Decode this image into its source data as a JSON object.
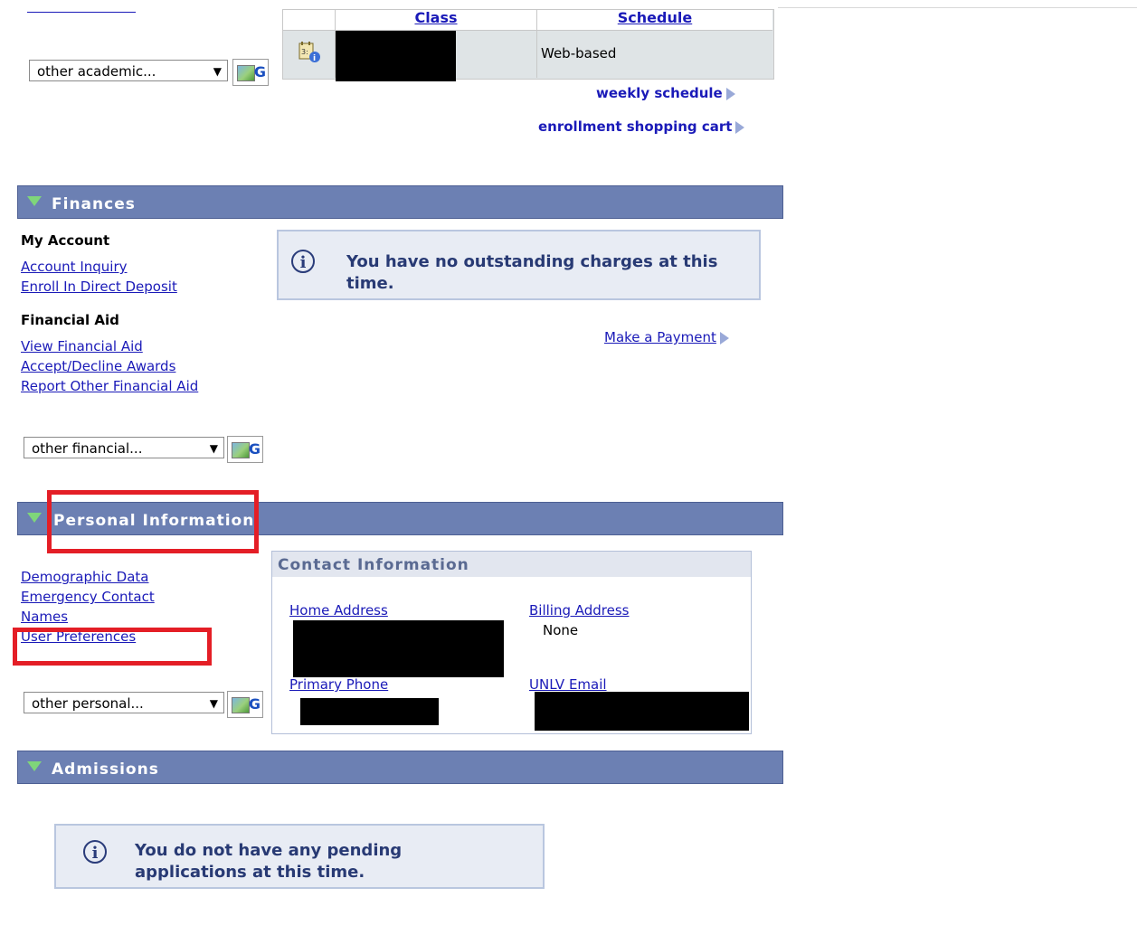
{
  "enrollment": {
    "table": {
      "headers": [
        "",
        "Class",
        "Schedule"
      ],
      "rows": [
        {
          "class": "",
          "schedule": "Web-based"
        }
      ]
    },
    "weekly_schedule_label": "weekly schedule",
    "shopping_cart_label": "enrollment shopping cart",
    "other_select": "other academic..."
  },
  "finances": {
    "title": "Finances",
    "my_account": {
      "title": "My Account",
      "links": [
        "Account Inquiry",
        "Enroll In Direct Deposit"
      ]
    },
    "financial_aid": {
      "title": "Financial Aid",
      "links": [
        "View Financial Aid",
        "Accept/Decline Awards",
        "Report Other Financial Aid"
      ]
    },
    "message": "You have no outstanding charges at this time.",
    "make_payment": "Make a Payment",
    "other_select": "other financial..."
  },
  "personal": {
    "title": "Personal Information",
    "links": [
      "Demographic Data",
      "Emergency Contact",
      "Names",
      "User Preferences"
    ],
    "other_select": "other personal...",
    "contact": {
      "title": "Contact Information",
      "home_address_label": "Home Address",
      "billing_address_label": "Billing Address",
      "billing_address_value": "None",
      "primary_phone_label": "Primary Phone",
      "email_label": "UNLV Email"
    }
  },
  "admissions": {
    "title": "Admissions",
    "message": "You do not have any pending applications at this time."
  },
  "colors": {
    "section_bar": "#6c80b3",
    "link": "#1a1ab8",
    "highlight_box": "#e41e26"
  }
}
